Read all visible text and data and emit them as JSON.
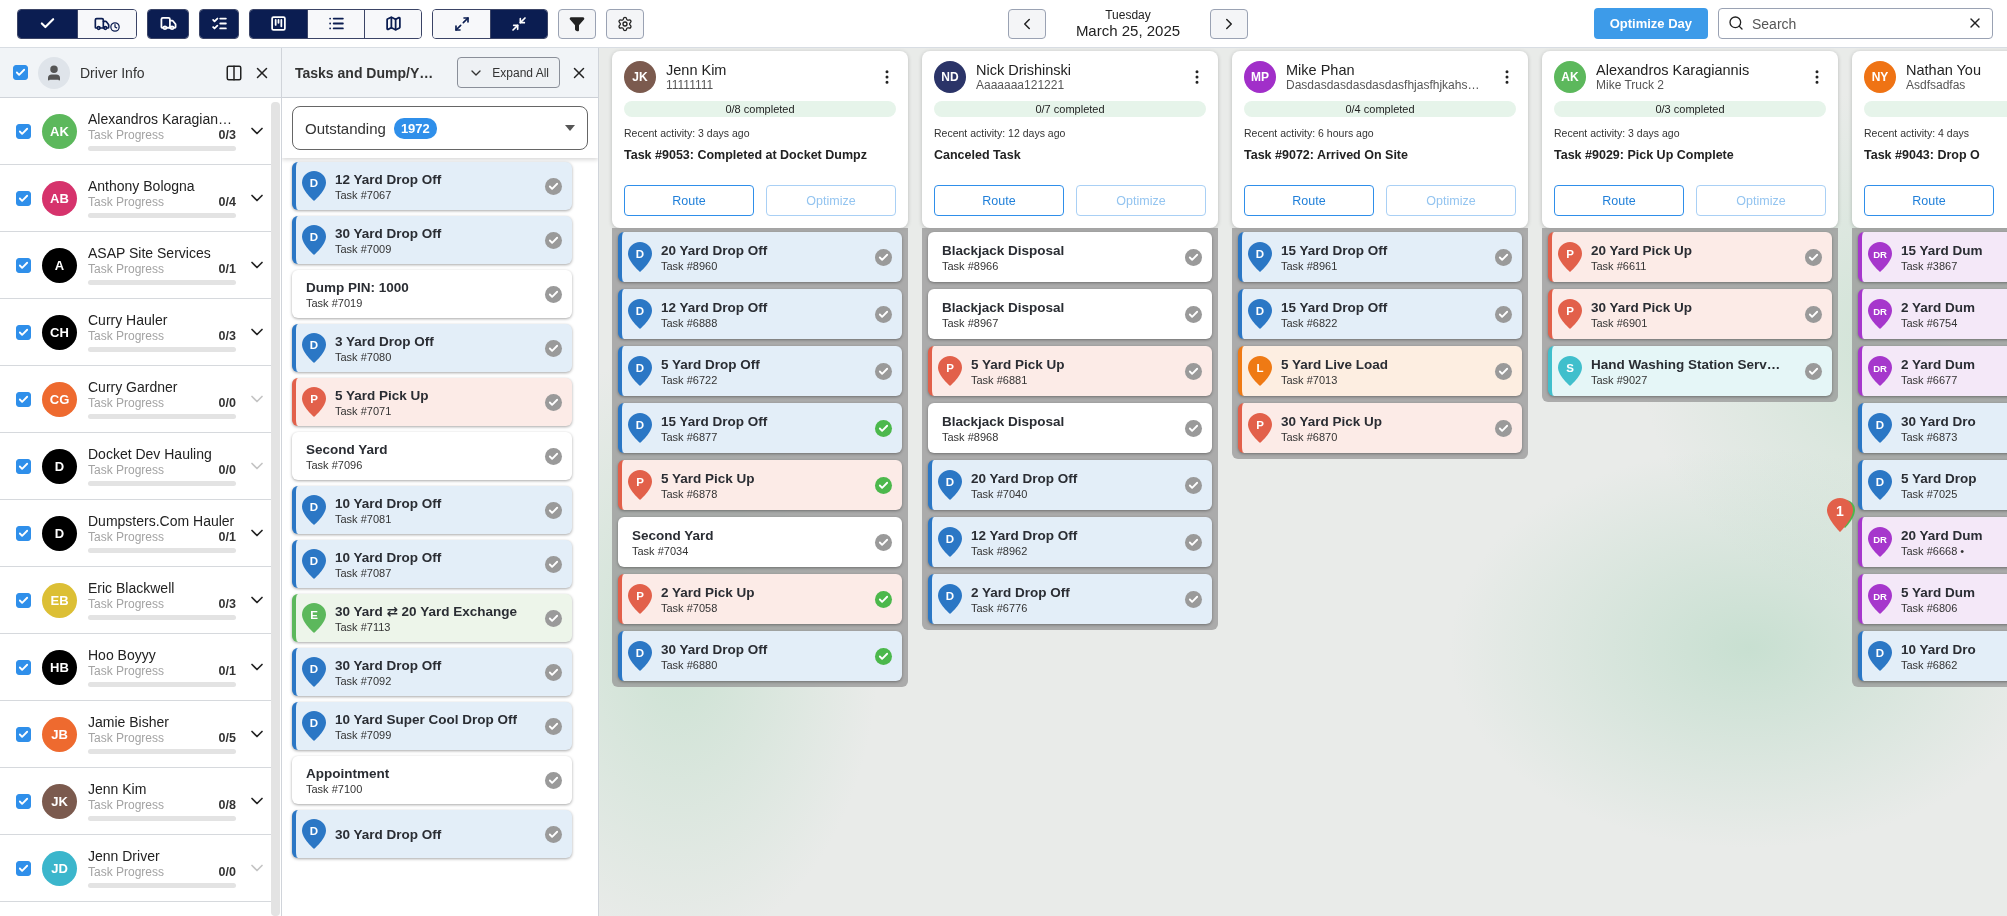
{
  "toolbar": {
    "groups": [
      {
        "buttons": [
          {
            "kind": "check",
            "selected": true
          },
          {
            "kind": "truck-clock",
            "selected": false
          }
        ]
      },
      {
        "buttons": [
          {
            "kind": "truck",
            "selected": true
          }
        ]
      },
      {
        "buttons": [
          {
            "kind": "checklist",
            "selected": true
          }
        ]
      },
      {
        "buttons": [
          {
            "kind": "board",
            "selected": true
          },
          {
            "kind": "list",
            "selected": false
          },
          {
            "kind": "map",
            "selected": false
          }
        ]
      },
      {
        "buttons": [
          {
            "kind": "expand",
            "selected": false
          },
          {
            "kind": "collapse",
            "selected": true
          }
        ]
      }
    ],
    "weekday": "Tuesday",
    "date": "March 25, 2025",
    "optimize_button": "Optimize Day",
    "search": {
      "placeholder": "Search"
    }
  },
  "driver_panel": {
    "title": "Driver Info",
    "all_checked": true,
    "drivers": [
      {
        "name": "Alexandros Karagian…",
        "initials": "AK",
        "color": "#5cb85c",
        "progress_label": "Task Progress",
        "count": "0/3",
        "checked": true,
        "disabled": false
      },
      {
        "name": "Anthony Bologna",
        "initials": "AB",
        "color": "#d6336c",
        "progress_label": "Task Progress",
        "count": "0/4",
        "checked": true,
        "disabled": false
      },
      {
        "name": "ASAP Site Services",
        "initials": "A",
        "color": "#000000",
        "progress_label": "Task Progress",
        "count": "0/1",
        "checked": true,
        "disabled": false
      },
      {
        "name": "Curry Hauler",
        "initials": "CH",
        "color": "#000000",
        "progress_label": "Task Progress",
        "count": "0/3",
        "checked": true,
        "disabled": false
      },
      {
        "name": "Curry Gardner",
        "initials": "CG",
        "color": "#ee6a2f",
        "progress_label": "Task Progress",
        "count": "0/0",
        "checked": true,
        "disabled": true
      },
      {
        "name": "Docket Dev Hauling",
        "initials": "D",
        "color": "#000000",
        "progress_label": "Task Progress",
        "count": "0/0",
        "checked": true,
        "disabled": true
      },
      {
        "name": "Dumpsters.Com Hauler",
        "initials": "D",
        "color": "#000000",
        "progress_label": "Task Progress",
        "count": "0/1",
        "checked": true,
        "disabled": false
      },
      {
        "name": "Eric Blackwell",
        "initials": "EB",
        "color": "#dcbf35",
        "progress_label": "Task Progress",
        "count": "0/3",
        "checked": true,
        "disabled": false
      },
      {
        "name": "Hoo Boyyy",
        "initials": "HB",
        "color": "#000000",
        "progress_label": "Task Progress",
        "count": "0/1",
        "checked": true,
        "disabled": false
      },
      {
        "name": "Jamie Bisher",
        "initials": "JB",
        "color": "#ee6a2f",
        "progress_label": "Task Progress",
        "count": "0/5",
        "checked": true,
        "disabled": false
      },
      {
        "name": "Jenn Kim",
        "initials": "JK",
        "color": "#7b5a4e",
        "progress_label": "Task Progress",
        "count": "0/8",
        "checked": true,
        "disabled": false
      },
      {
        "name": "Jenn Driver",
        "initials": "JD",
        "color": "#3bb6cc",
        "progress_label": "Task Progress",
        "count": "0/0",
        "checked": true,
        "disabled": true
      }
    ]
  },
  "task_panel": {
    "title": "Tasks and Dump/Y…",
    "expand_button": "Expand All",
    "filter": {
      "value": "Outstanding",
      "count": "1972"
    },
    "tasks": [
      {
        "kind": "delivery",
        "pin": "D",
        "title": "12 Yard Drop Off",
        "subtitle": "Task #7067",
        "color": "#9a9a9a"
      },
      {
        "kind": "delivery",
        "pin": "D",
        "title": "30 Yard Drop Off",
        "subtitle": "Task #7009",
        "color": "#9a9a9a"
      },
      {
        "kind": "plain",
        "title": "Dump PIN: 1000",
        "subtitle": "Task #7019",
        "color": "#9a9a9a"
      },
      {
        "kind": "delivery",
        "pin": "D",
        "title": "3 Yard Drop Off",
        "subtitle": "Task #7080",
        "color": "#9a9a9a"
      },
      {
        "kind": "pickup",
        "pin": "P",
        "title": "5 Yard Pick Up",
        "subtitle": "Task #7071",
        "color": "#9a9a9a"
      },
      {
        "kind": "plain",
        "title": "Second Yard",
        "subtitle": "Task #7096",
        "color": "#9a9a9a"
      },
      {
        "kind": "delivery",
        "pin": "D",
        "title": "10 Yard Drop Off",
        "subtitle": "Task #7081",
        "color": "#9a9a9a"
      },
      {
        "kind": "delivery",
        "pin": "D",
        "title": "10 Yard Drop Off",
        "subtitle": "Task #7087",
        "color": "#9a9a9a"
      },
      {
        "kind": "exchange",
        "pin": "E",
        "title": "30 Yard ⇄ 20 Yard Exchange",
        "subtitle": "Task #7113",
        "color": "#9a9a9a"
      },
      {
        "kind": "delivery",
        "pin": "D",
        "title": "30 Yard Drop Off",
        "subtitle": "Task #7092",
        "color": "#9a9a9a"
      },
      {
        "kind": "delivery",
        "pin": "D",
        "title": "10 Yard Super Cool Drop Off",
        "subtitle": "Task #7099",
        "color": "#9a9a9a"
      },
      {
        "kind": "plain",
        "title": "Appointment",
        "subtitle": "Task #7100",
        "color": "#9a9a9a"
      },
      {
        "kind": "delivery",
        "pin": "D",
        "title": "30 Yard Drop Off",
        "color": "#9a9a9a"
      }
    ]
  },
  "board": {
    "columns": [
      {
        "driver": {
          "name": "Jenn Kim",
          "initials": "JK",
          "color": "#7b5a4e",
          "subtitle": "11111111"
        },
        "progress": "0/8 completed",
        "activity": "Recent activity: 3 days ago",
        "last_task": "Task #9053: Completed at Docket Dumpz",
        "route_button": "Route",
        "optimize_button": "Optimize",
        "optimize_disabled": true,
        "tasks": [
          {
            "kind": "delivery",
            "pin": "D",
            "title": "20 Yard Drop Off",
            "subtitle": "Task #8960",
            "color": "#9a9a9a"
          },
          {
            "kind": "delivery",
            "pin": "D",
            "title": "12 Yard Drop Off",
            "subtitle": "Task #6888",
            "color": "#9a9a9a"
          },
          {
            "kind": "delivery",
            "pin": "D",
            "title": "5 Yard Drop Off",
            "subtitle": "Task #6722",
            "color": "#9a9a9a"
          },
          {
            "kind": "delivery",
            "pin": "D",
            "title": "15 Yard Drop Off",
            "subtitle": "Task #6877",
            "color": "#4cb84c"
          },
          {
            "kind": "pickup",
            "pin": "P",
            "title": "5 Yard Pick Up",
            "subtitle": "Task #6878",
            "color": "#4cb84c"
          },
          {
            "kind": "plain",
            "title": "Second Yard",
            "subtitle": "Task #7034",
            "color": "#9a9a9a"
          },
          {
            "kind": "pickup",
            "pin": "P",
            "title": "2 Yard Pick Up",
            "subtitle": "Task #7058",
            "color": "#4cb84c"
          },
          {
            "kind": "delivery",
            "pin": "D",
            "title": "30 Yard Drop Off",
            "subtitle": "Task #6880",
            "color": "#4cb84c"
          }
        ]
      },
      {
        "driver": {
          "name": "Nick Drishinski",
          "initials": "ND",
          "color": "#2b3468",
          "subtitle": "Aaaaaaa121221"
        },
        "progress": "0/7 completed",
        "activity": "Recent activity: 12 days ago",
        "last_task": "Canceled Task",
        "route_button": "Route",
        "optimize_button": "Optimize",
        "optimize_disabled": true,
        "tasks": [
          {
            "kind": "plain",
            "title": "Blackjack Disposal",
            "subtitle": "Task #8966",
            "color": "#9a9a9a"
          },
          {
            "kind": "plain",
            "title": "Blackjack Disposal",
            "subtitle": "Task #8967",
            "color": "#9a9a9a"
          },
          {
            "kind": "pickup",
            "pin": "P",
            "title": "5 Yard Pick Up",
            "subtitle": "Task #6881",
            "color": "#9a9a9a"
          },
          {
            "kind": "plain",
            "title": "Blackjack Disposal",
            "subtitle": "Task #8968",
            "color": "#9a9a9a"
          },
          {
            "kind": "delivery",
            "pin": "D",
            "title": "20 Yard Drop Off",
            "subtitle": "Task #7040",
            "color": "#9a9a9a"
          },
          {
            "kind": "delivery",
            "pin": "D",
            "title": "12 Yard Drop Off",
            "subtitle": "Task #8962",
            "color": "#9a9a9a"
          },
          {
            "kind": "delivery",
            "pin": "D",
            "title": "2 Yard Drop Off",
            "subtitle": "Task #6776",
            "color": "#9a9a9a"
          }
        ]
      },
      {
        "driver": {
          "name": "Mike Phan",
          "initials": "MP",
          "color": "#a12fc9",
          "subtitle": "Dasdasdasdasdasdasfhjasfhjkahs…"
        },
        "progress": "0/4 completed",
        "activity": "Recent activity: 6 hours ago",
        "last_task": "Task #9072: Arrived On Site",
        "route_button": "Route",
        "optimize_button": "Optimize",
        "optimize_disabled": true,
        "tasks": [
          {
            "kind": "delivery",
            "pin": "D",
            "title": "15 Yard Drop Off",
            "subtitle": "Task #8961",
            "color": "#9a9a9a"
          },
          {
            "kind": "delivery",
            "pin": "D",
            "title": "15 Yard Drop Off",
            "subtitle": "Task #6822",
            "color": "#9a9a9a"
          },
          {
            "kind": "liveload",
            "pin": "L",
            "title": "5 Yard Live Load",
            "subtitle": "Task #7013",
            "color": "#9a9a9a"
          },
          {
            "kind": "pickup",
            "pin": "P",
            "title": "30 Yard Pick Up",
            "subtitle": "Task #6870",
            "color": "#9a9a9a"
          }
        ]
      },
      {
        "driver": {
          "name": "Alexandros Karagiannis",
          "initials": "AK",
          "color": "#5cb85c",
          "subtitle": "Mike Truck 2"
        },
        "progress": "0/3 completed",
        "activity": "Recent activity: 3 days ago",
        "last_task": "Task #9029: Pick Up Complete",
        "route_button": "Route",
        "optimize_button": "Optimize",
        "optimize_disabled": true,
        "tasks": [
          {
            "kind": "pickup",
            "pin": "P",
            "title": "20 Yard Pick Up",
            "subtitle": "Task #6611",
            "color": "#9a9a9a"
          },
          {
            "kind": "pickup",
            "pin": "P",
            "title": "30 Yard Pick Up",
            "subtitle": "Task #6901",
            "color": "#9a9a9a"
          },
          {
            "kind": "service",
            "pin": "S",
            "title": "Hand Washing Station Serv…",
            "subtitle": "Task #9027",
            "color": "#9a9a9a"
          }
        ]
      },
      {
        "driver": {
          "name": "Nathan You",
          "initials": "NY",
          "color": "#ef7314",
          "subtitle": "Asdfsadfas"
        },
        "activity": "Recent activity: 4 days",
        "last_task": "Task #9043: Drop O",
        "route_button": "Route",
        "tasks": [
          {
            "kind": "dump",
            "pin": "DR",
            "title": "15 Yard Dum",
            "subtitle": "Task #3867"
          },
          {
            "kind": "dump",
            "pin": "DR",
            "title": "2 Yard Dum",
            "subtitle": "Task #6754"
          },
          {
            "kind": "dump",
            "pin": "DR",
            "title": "2 Yard Dum",
            "subtitle": "Task #6677"
          },
          {
            "kind": "delivery",
            "pin": "D",
            "title": "30 Yard Dro",
            "subtitle": "Task #6873"
          },
          {
            "kind": "delivery",
            "pin": "D",
            "title": "5 Yard Drop",
            "subtitle": "Task #7025"
          },
          {
            "kind": "dump",
            "pin": "DR",
            "title": "20 Yard Dum",
            "subtitle": "Task #6668 •"
          },
          {
            "kind": "dump",
            "pin": "DR",
            "title": "5 Yard Dum",
            "subtitle": "Task #6806"
          },
          {
            "kind": "delivery",
            "pin": "D",
            "title": "10 Yard Dro",
            "subtitle": "Task #6862"
          }
        ]
      }
    ]
  },
  "map": {
    "marker": "1"
  }
}
